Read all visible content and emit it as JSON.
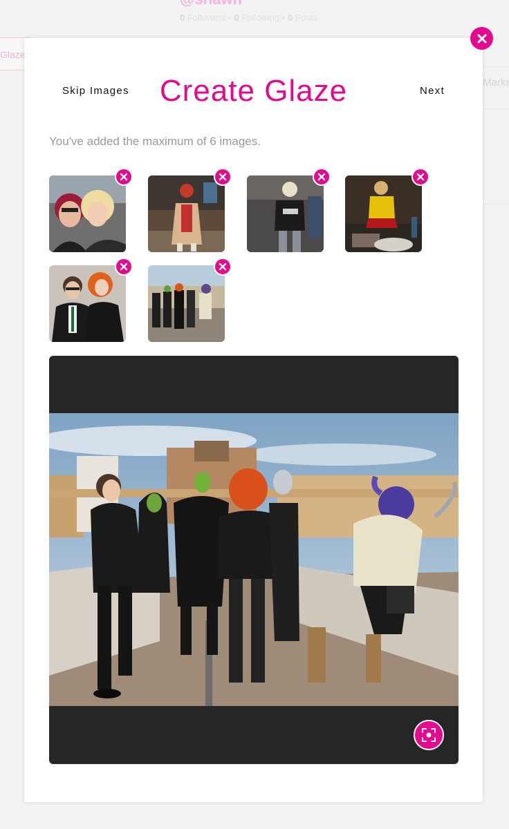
{
  "background": {
    "handle": "@shawn",
    "stats": {
      "followers_count": "0",
      "followers_label": "Followers",
      "following_count": "0",
      "following_label": "Following",
      "posts_count": "0",
      "posts_label": "Posts",
      "separator": "•"
    },
    "left_tab_label": "Glaze",
    "right_panel_label": "Marketp"
  },
  "modal": {
    "skip_label": "Skip Images",
    "title": "Create Glaze",
    "next_label": "Next",
    "max_message": "You've added the maximum of 6 images.",
    "close_icon": "close-icon",
    "thumbnails": [
      {
        "name": "thumbnail-1",
        "remove_icon": "close-icon"
      },
      {
        "name": "thumbnail-2",
        "remove_icon": "close-icon"
      },
      {
        "name": "thumbnail-3",
        "remove_icon": "close-icon"
      },
      {
        "name": "thumbnail-4",
        "remove_icon": "close-icon"
      },
      {
        "name": "thumbnail-5",
        "remove_icon": "close-icon"
      },
      {
        "name": "thumbnail-6",
        "remove_icon": "close-icon"
      }
    ],
    "crop_icon": "crop-focus-icon"
  },
  "colors": {
    "accent": "#e5098f",
    "preview_bg": "#262626",
    "page_bg": "#f2f2f2"
  }
}
